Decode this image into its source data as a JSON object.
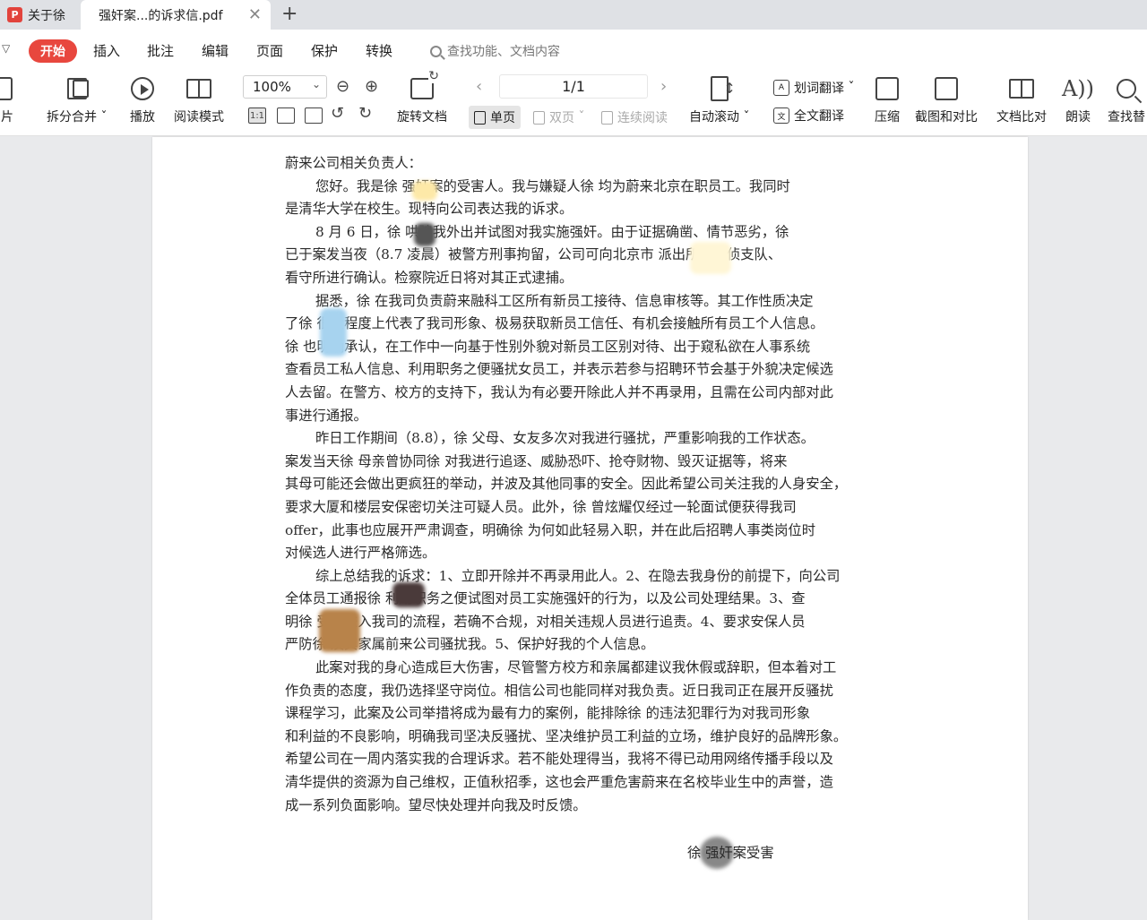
{
  "tabs": [
    {
      "label": "关于徐",
      "icon": "pdf-icon"
    },
    {
      "label": "强奸案...的诉求信.pdf"
    }
  ],
  "menu": {
    "items": [
      "开始",
      "插入",
      "批注",
      "编辑",
      "页面",
      "保护",
      "转换"
    ],
    "active": "开始",
    "search_placeholder": "查找功能、文档内容"
  },
  "toolbar": {
    "image_label": "图片",
    "split_merge": "拆分合并",
    "play": "播放",
    "read_mode": "阅读模式",
    "zoom": "100%",
    "rotate_doc": "旋转文档",
    "page_indicator": "1/1",
    "single_page": "单页",
    "double_page": "双页",
    "continuous": "连续阅读",
    "auto_scroll": "自动滚动",
    "word_translate": "划词翻译",
    "full_translate": "全文翻译",
    "compress": "压缩",
    "screenshot_compare": "截图和对比",
    "doc_compare": "文档比对",
    "read_aloud": "朗读",
    "find_replace": "查找替"
  },
  "document": {
    "lines": [
      {
        "text": "蔚来公司相关负责人：",
        "indent": false
      },
      {
        "text": "您好。我是徐      强奸案的受害人。我与嫌疑人徐      均为蔚来北京在职员工。我同时",
        "indent": true
      },
      {
        "text": "是清华大学在校生。现特向公司表达我的诉求。",
        "indent": false
      },
      {
        "text": "8 月 6 日，徐      哄骗我外出并试图对我实施强奸。由于证据确凿、情节恶劣，徐",
        "indent": true
      },
      {
        "text": "已于案发当夜（8.7 凌晨）被警方刑事拘留，公司可向北京市            派出所、刑侦支队、",
        "indent": false
      },
      {
        "text": "看守所进行确认。检察院近日将对其正式逮捕。",
        "indent": false
      },
      {
        "text": "据悉，徐      在我司负责蔚来融科工区所有新员工接待、信息审核等。其工作性质决定",
        "indent": true
      },
      {
        "text": "了徐      很大程度上代表了我司形象、极易获取新员工信任、有机会接触所有员工个人信息。",
        "indent": false
      },
      {
        "text": "徐      也明确承认，在工作中一向基于性别外貌对新员工区别对待、出于窥私欲在人事系统",
        "indent": false
      },
      {
        "text": "查看员工私人信息、利用职务之便骚扰女员工，并表示若参与招聘环节会基于外貌决定候选",
        "indent": false
      },
      {
        "text": "人去留。在警方、校方的支持下，我认为有必要开除此人并不再录用，且需在公司内部对此",
        "indent": false
      },
      {
        "text": "事进行通报。",
        "indent": false
      },
      {
        "text": "昨日工作期间（8.8），徐      父母、女友多次对我进行骚扰，严重影响我的工作状态。",
        "indent": true
      },
      {
        "text": "案发当天徐      母亲曾协同徐      对我进行追逐、威胁恐吓、抢夺财物、毁灭证据等，将来",
        "indent": false
      },
      {
        "text": "其母可能还会做出更疯狂的举动，并波及其他同事的安全。因此希望公司关注我的人身安全，",
        "indent": false
      },
      {
        "text": "要求大厦和楼层安保密切关注可疑人员。此外，徐      曾炫耀仅经过一轮面试便获得我司",
        "indent": false
      },
      {
        "text": "offer，此事也应展开严肃调查，明确徐      为何如此轻易入职，并在此后招聘人事类岗位时",
        "indent": false
      },
      {
        "text": "对候选人进行严格筛选。",
        "indent": false
      },
      {
        "text": "综上总结我的诉求：1、立即开除并不再录用此人。2、在隐去我身份的前提下，向公司",
        "indent": true
      },
      {
        "text": "全体员工通报徐      利用职务之便试图对员工实施强奸的行为，以及公司处理结果。3、查",
        "indent": false
      },
      {
        "text": "明徐      受聘进入我司的流程，若确不合规，对相关违规人员进行追责。4、要求安保人员",
        "indent": false
      },
      {
        "text": "严防徐      及其家属前来公司骚扰我。5、保护好我的个人信息。",
        "indent": false
      },
      {
        "text": "此案对我的身心造成巨大伤害，尽管警方校方和亲属都建议我休假或辞职，但本着对工",
        "indent": true
      },
      {
        "text": "作负责的态度，我仍选择坚守岗位。相信公司也能同样对我负责。近日我司正在展开反骚扰",
        "indent": false
      },
      {
        "text": "课程学习，此案及公司举措将成为最有力的案例，能排除徐      的违法犯罪行为对我司形象",
        "indent": false
      },
      {
        "text": "和利益的不良影响，明确我司坚决反骚扰、坚决维护员工利益的立场，维护良好的品牌形象。",
        "indent": false
      },
      {
        "text": "希望公司在一周内落实我的合理诉求。若不能处理得当，我将不得已动用网络传播手段以及",
        "indent": false
      },
      {
        "text": "清华提供的资源为自己维权，正值秋招季，这也会严重危害蔚来在名校毕业生中的声誉，造",
        "indent": false
      },
      {
        "text": "成一系列负面影响。望尽快处理并向我及时反馈。",
        "indent": false
      }
    ],
    "signature": "徐      强奸案受害"
  },
  "colors": {
    "accent": "#e8473e",
    "page_bg": "#ffffff",
    "canvas_bg": "#e9eaec"
  }
}
